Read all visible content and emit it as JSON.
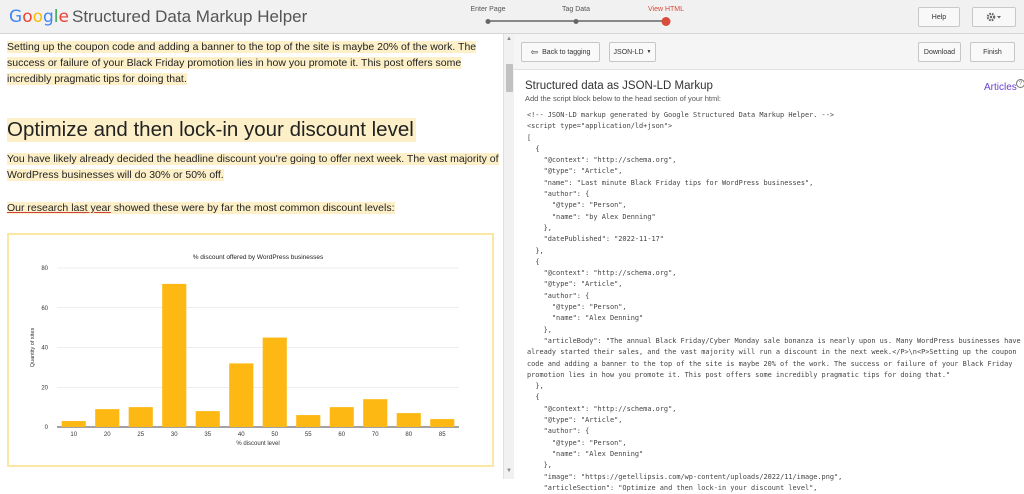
{
  "app": {
    "logo_letters": [
      {
        "ch": "G",
        "color": "#4285F4"
      },
      {
        "ch": "o",
        "color": "#EA4335"
      },
      {
        "ch": "o",
        "color": "#FBBC05"
      },
      {
        "ch": "g",
        "color": "#4285F4"
      },
      {
        "ch": "l",
        "color": "#34A853"
      },
      {
        "ch": "e",
        "color": "#EA4335"
      }
    ],
    "title": "Structured Data Markup Helper"
  },
  "steps": [
    {
      "label": "Enter Page",
      "active": false
    },
    {
      "label": "Tag Data",
      "active": false
    },
    {
      "label": "View HTML",
      "active": true
    }
  ],
  "topbar": {
    "help_label": "Help",
    "settings_icon": "gear-icon"
  },
  "article": {
    "intro": "Setting up the coupon code and adding a banner to the top of the site is maybe 20% of the work. The success or failure of your Black Friday promotion lies in how you promote it. This post offers some incredibly pragmatic tips for doing that.",
    "heading": "Optimize and then lock-in your discount level",
    "para2": "You have likely already decided the headline discount you're going to offer next week. The vast majority of WordPress businesses will do 30% or 50% off.",
    "link_text": "Our research last year",
    "para3_rest": " showed these were by far the most common discount levels:"
  },
  "chart_data": {
    "type": "bar",
    "title": "% discount offered by WordPress businesses",
    "xlabel": "% discount level",
    "ylabel": "Quantity of sites",
    "categories": [
      "10",
      "20",
      "25",
      "30",
      "35",
      "40",
      "50",
      "55",
      "60",
      "70",
      "80",
      "85"
    ],
    "values": [
      3,
      9,
      10,
      72,
      8,
      32,
      45,
      6,
      10,
      14,
      7,
      4
    ],
    "ylim": [
      0,
      80
    ],
    "yticks": [
      0,
      20,
      40,
      60,
      80
    ],
    "grid": true,
    "bar_color": "#FDB813"
  },
  "right_toolbar": {
    "back_label": "Back to tagging",
    "format_label": "JSON-LD",
    "download_label": "Download",
    "finish_label": "Finish"
  },
  "output": {
    "title": "Structured data as JSON-LD Markup",
    "subtitle": "Add the script block below to the head section of your html:",
    "articles_label": "Articles",
    "code": "<!-- JSON-LD markup generated by Google Structured Data Markup Helper. -->\n<script type=\"application/ld+json\">\n[\n  {\n    \"@context\": \"http://schema.org\",\n    \"@type\": \"Article\",\n    \"name\": \"Last minute Black Friday tips for WordPress businesses\",\n    \"author\": {\n      \"@type\": \"Person\",\n      \"name\": \"by Alex Denning\"\n    },\n    \"datePublished\": \"2022-11-17\"\n  },\n  {\n    \"@context\": \"http://schema.org\",\n    \"@type\": \"Article\",\n    \"author\": {\n      \"@type\": \"Person\",\n      \"name\": \"Alex Denning\"\n    },\n    \"articleBody\": \"The annual Black Friday/Cyber Monday sale bonanza is nearly upon us. Many WordPress businesses have already started their sales, and the vast majority will run a discount in the next week.</P>\\n<P>Setting up the coupon code and adding a banner to the top of the site is maybe 20% of the work. The success or failure of your Black Friday promotion lies in how you promote it. This post offers some incredibly pragmatic tips for doing that.\"\n  },\n  {\n    \"@context\": \"http://schema.org\",\n    \"@type\": \"Article\",\n    \"author\": {\n      \"@type\": \"Person\",\n      \"name\": \"Alex Denning\"\n    },\n    \"image\": \"https://getellipsis.com/wp-content/uploads/2022/11/image.png\",\n    \"articleSection\": \"Optimize and then lock-in your discount level\","
  }
}
